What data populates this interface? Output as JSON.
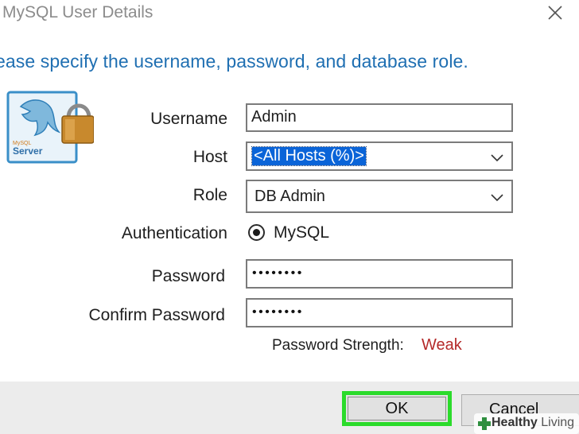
{
  "window": {
    "title": "MySQL User Details",
    "close_icon": "close-icon"
  },
  "instruction": "ease specify the username, password, and database role.",
  "logo": {
    "icon": "mysql-server-lock-icon",
    "text_top": "MySQL",
    "text_bottom": "Server"
  },
  "form": {
    "username_label": "Username",
    "username_value": "Admin",
    "host_label": "Host",
    "host_value": "<All Hosts (%)>",
    "role_label": "Role",
    "role_value": "DB Admin",
    "auth_label": "Authentication",
    "auth_option": "MySQL",
    "password_label": "Password",
    "password_value": "••••••••",
    "confirm_label": "Confirm Password",
    "confirm_value": "••••••••",
    "strength_label": "Password Strength:",
    "strength_value": "Weak"
  },
  "buttons": {
    "ok": "OK",
    "cancel": "Cancel"
  },
  "watermark": {
    "brand_bold": "Healthy",
    "brand_rest": " Living"
  },
  "colors": {
    "instruction": "#1f6fb2",
    "selection": "#0a64d8",
    "weak": "#b42a2a",
    "highlight": "#2bdb2b"
  }
}
